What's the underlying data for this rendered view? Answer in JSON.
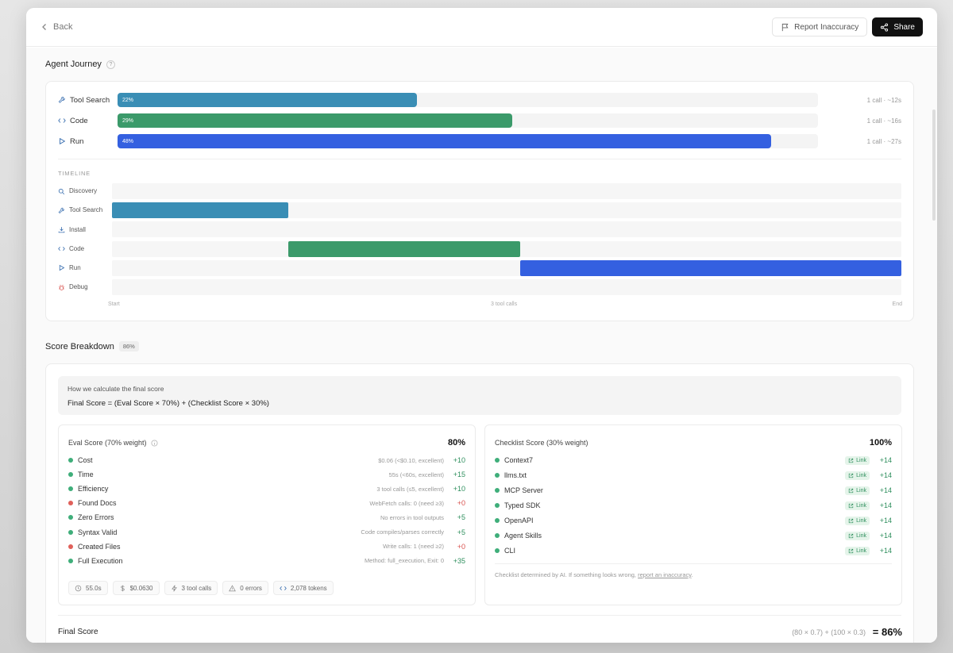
{
  "header": {
    "back_label": "Back",
    "report_label": "Report Inaccuracy",
    "share_label": "Share"
  },
  "journey": {
    "title": "Agent Journey",
    "help": "?",
    "rows": [
      {
        "label": "Tool Search",
        "percent": 22,
        "percent_label": "22%",
        "meta": "1 call · ~12s",
        "color": "#3a8eb5",
        "icon": "wrench-icon"
      },
      {
        "label": "Code",
        "percent": 29,
        "percent_label": "29%",
        "meta": "1 call · ~16s",
        "color": "#3b9a6a",
        "icon": "code-icon"
      },
      {
        "label": "Run",
        "percent": 48,
        "percent_label": "48%",
        "meta": "1 call · ~27s",
        "color": "#3460e0",
        "icon": "play-icon"
      }
    ],
    "timeline": {
      "title": "TIMELINE",
      "rows": [
        {
          "label": "Discovery",
          "icon": "search-icon"
        },
        {
          "label": "Tool Search",
          "icon": "wrench-icon",
          "start": 0,
          "end": 0.223,
          "color": "#3a8eb5"
        },
        {
          "label": "Install",
          "icon": "download-icon"
        },
        {
          "label": "Code",
          "icon": "code-icon",
          "start": 0.223,
          "end": 0.517,
          "color": "#3b9a6a"
        },
        {
          "label": "Run",
          "icon": "play-icon",
          "start": 0.517,
          "end": 1.0,
          "color": "#3460e0"
        },
        {
          "label": "Debug",
          "icon": "bug-icon"
        }
      ],
      "axis_start": "Start",
      "axis_mid": "3 tool calls",
      "axis_end": "End"
    }
  },
  "score": {
    "title": "Score Breakdown",
    "badge": "86%",
    "formula_title": "How we calculate the final score",
    "formula": "Final Score = (Eval Score × 70%) + (Checklist Score × 30%)",
    "eval": {
      "title": "Eval Score (70% weight)",
      "value": "80%",
      "rows": [
        {
          "label": "Cost",
          "desc": "$0.06 (<$0.10, excellent)",
          "pts": "+10",
          "status": "pass"
        },
        {
          "label": "Time",
          "desc": "55s (<60s, excellent)",
          "pts": "+15",
          "status": "pass"
        },
        {
          "label": "Efficiency",
          "desc": "3 tool calls (≤5, excellent)",
          "pts": "+10",
          "status": "pass"
        },
        {
          "label": "Found Docs",
          "desc": "WebFetch calls: 0 (need ≥3)",
          "pts": "+0",
          "status": "fail"
        },
        {
          "label": "Zero Errors",
          "desc": "No errors in tool outputs",
          "pts": "+5",
          "status": "pass"
        },
        {
          "label": "Syntax Valid",
          "desc": "Code compiles/parses correctly",
          "pts": "+5",
          "status": "pass"
        },
        {
          "label": "Created Files",
          "desc": "Write calls: 1 (need ≥2)",
          "pts": "+0",
          "status": "fail"
        },
        {
          "label": "Full Execution",
          "desc": "Method: full_execution, Exit: 0",
          "pts": "+35",
          "status": "pass"
        }
      ],
      "chips": [
        {
          "icon": "clock-icon",
          "text": "55.0s"
        },
        {
          "icon": "dollar-icon",
          "text": "$0.0630"
        },
        {
          "icon": "bolt-icon",
          "text": "3 tool calls"
        },
        {
          "icon": "warning-icon",
          "text": "0 errors"
        },
        {
          "icon": "code-icon",
          "text": "2,078 tokens"
        }
      ]
    },
    "checklist": {
      "title": "Checklist Score (30% weight)",
      "value": "100%",
      "link_label": "Link",
      "rows": [
        {
          "label": "Context7",
          "pts": "+14"
        },
        {
          "label": "llms.txt",
          "pts": "+14"
        },
        {
          "label": "MCP Server",
          "pts": "+14"
        },
        {
          "label": "Typed SDK",
          "pts": "+14"
        },
        {
          "label": "OpenAPI",
          "pts": "+14"
        },
        {
          "label": "Agent Skills",
          "pts": "+14"
        },
        {
          "label": "CLI",
          "pts": "+14"
        }
      ],
      "note_text": "Checklist determined by AI. If something looks wrong, ",
      "note_link": "report an inaccuracy",
      "note_end": "."
    },
    "final": {
      "label": "Final Score",
      "calc": "(80 × 0.7) + (100 × 0.3)",
      "value": "= 86%"
    }
  },
  "colors": {
    "pass": "#3fae7a",
    "fail": "#e0605a"
  }
}
